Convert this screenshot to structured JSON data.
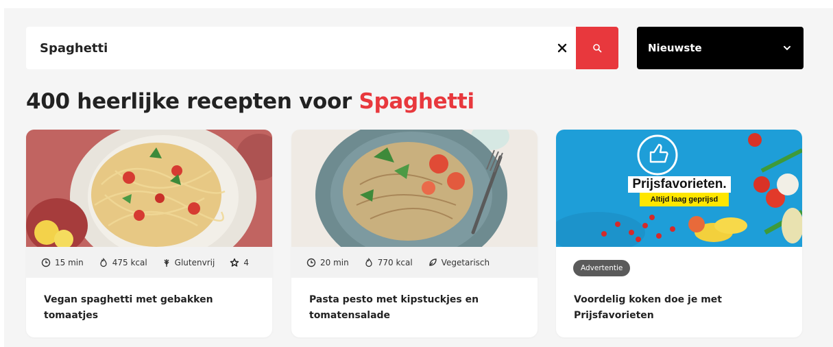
{
  "search": {
    "value": "Spaghetti",
    "clear_icon": "close-icon",
    "search_icon": "search-icon"
  },
  "sort": {
    "selected": "Nieuwste",
    "icon": "chevron-down-icon"
  },
  "heading": {
    "prefix": "400 heerlijke recepten voor ",
    "term": "Spaghetti"
  },
  "cards": [
    {
      "meta": [
        {
          "icon": "clock-icon",
          "text": "15 min"
        },
        {
          "icon": "flame-icon",
          "text": "475 kcal"
        },
        {
          "icon": "glutenfree-icon",
          "text": "Glutenvrij"
        },
        {
          "icon": "star-icon",
          "text": "4"
        }
      ],
      "title": "Vegan spaghetti met gebakken tomaatjes"
    },
    {
      "meta": [
        {
          "icon": "clock-icon",
          "text": "20 min"
        },
        {
          "icon": "flame-icon",
          "text": "770 kcal"
        },
        {
          "icon": "leaf-icon",
          "text": "Vegetarisch"
        }
      ],
      "title": "Pasta pesto met kipstuckjes en tomatensalade"
    },
    {
      "badge": "Advertentie",
      "title": "Voordelig koken doe je met Prijsfavorieten",
      "ad_image": {
        "logo_text": "Prijsfavorieten.",
        "tagline": "Altijd laag geprijsd"
      }
    }
  ],
  "colors": {
    "accent": "#e8383d",
    "sort_bg": "#000000",
    "ad_bg": "#1e9ed8",
    "badge_yellow": "#ffe600"
  }
}
